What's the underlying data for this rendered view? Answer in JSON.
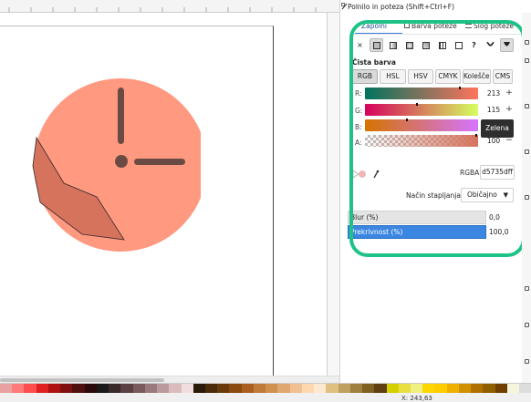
{
  "dialog": {
    "title": "Polnilo in poteza (Shift+Ctrl+F)",
    "tabs": [
      "Zapolni",
      "Barva poteze",
      "Slog poteze"
    ],
    "paint_types": [
      {
        "icon": "no-paint-icon",
        "glyph": "×"
      },
      {
        "icon": "flat-color-icon",
        "glyph": ""
      },
      {
        "icon": "linear-gradient-icon",
        "glyph": ""
      },
      {
        "icon": "radial-gradient-icon",
        "glyph": ""
      },
      {
        "icon": "mesh-gradient-icon",
        "glyph": ""
      },
      {
        "icon": "pattern-icon",
        "glyph": ""
      },
      {
        "icon": "swatch-icon",
        "glyph": ""
      },
      {
        "icon": "unset-paint-icon",
        "glyph": "?"
      },
      {
        "icon": "fill-rule-evenodd-icon",
        "glyph": ""
      },
      {
        "icon": "fill-rule-nonzero-icon",
        "glyph": ""
      }
    ],
    "flat_color_label": "Čista barva",
    "color_modes": [
      "RGB",
      "HSL",
      "HSV",
      "CMYK",
      "Kolešček",
      "CMS"
    ],
    "active_mode": "RGB",
    "channels": [
      {
        "label": "R:",
        "value": "213"
      },
      {
        "label": "G:",
        "value": "115"
      },
      {
        "label": "B:",
        "value": ""
      },
      {
        "label": "A:",
        "value": "100"
      }
    ],
    "tooltip": "Zelena",
    "rgba_label": "RGBA:",
    "rgba_value": "d5735dff",
    "blend_label": "Način stapljanja:",
    "blend_value": "Običajno",
    "blur_label": "Blur (%)",
    "blur_value": "0,0",
    "opacity_label": "Prekrivnost (%)",
    "opacity_value": "100,0"
  },
  "colors": {
    "clock_fill": "#ff9980",
    "hand_color": "#6b4a44",
    "polygon_fill": "#d5735d",
    "accent_ring": "#1dc386",
    "opacity_bar": "#3b86e0"
  },
  "palette": {
    "swatches": [
      "#e9a0a0",
      "#ff7a7a",
      "#ff4c4c",
      "#e02020",
      "#b01010",
      "#801010",
      "#501010",
      "#2a0a0a",
      "#1a1a1a",
      "#3a2a2a",
      "#5a4040",
      "#7a5a5a",
      "#9a7a7a",
      "#ba9a9a",
      "#dabcbc",
      "#f0dede",
      "#2a1a0a",
      "#4a2a0a",
      "#6a3a0a",
      "#8a4a10",
      "#aa6020",
      "#c07a3a",
      "#d09050",
      "#e0a870",
      "#f0c090",
      "#ffd8b0",
      "#ffe8d0",
      "#e0c080",
      "#c0a060",
      "#a08040",
      "#806020",
      "#604010",
      "#d4d000",
      "#e8e040",
      "#f0f080",
      "#ffd700",
      "#ffcc00",
      "#f0b000",
      "#d09000",
      "#b07000",
      "#906000",
      "#704000",
      "#f5f5dc",
      "#ddd"
    ],
    "status": "X: 243,63"
  }
}
